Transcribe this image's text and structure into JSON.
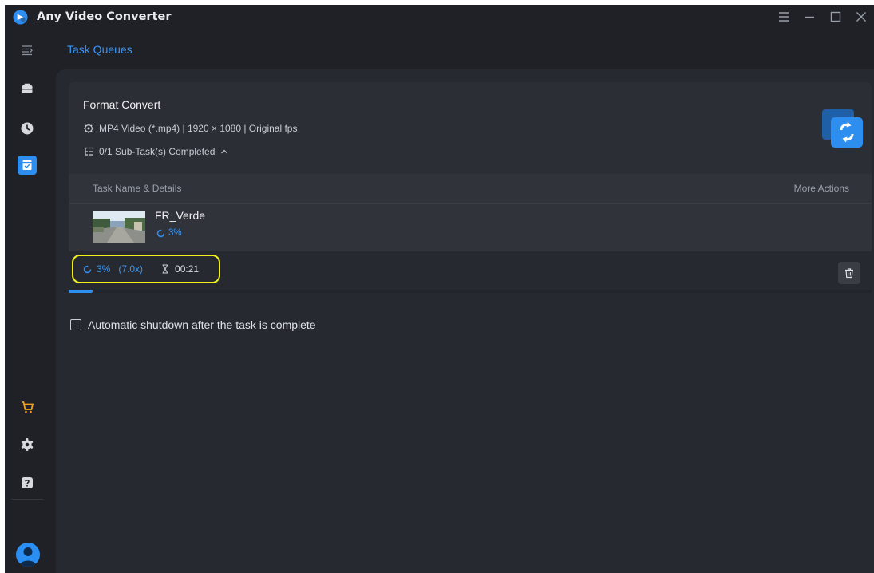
{
  "app": {
    "title": "Any Video Converter"
  },
  "header": {
    "title": "Task Queues"
  },
  "task": {
    "title": "Format Convert",
    "format_line": "MP4 Video (*.mp4) | 1920 × 1080 | Original fps",
    "subtasks_line": "0/1 Sub-Task(s) Completed",
    "table": {
      "col_name": "Task Name & Details",
      "col_actions": "More Actions"
    },
    "file": {
      "name": "FR_Verde",
      "progress_text": "3%"
    },
    "footer": {
      "percent": "3%",
      "speed": "(7.0x)",
      "remaining": "00:21"
    },
    "progress": 0.03
  },
  "shutdown_option": {
    "label": "Automatic shutdown after the task is complete",
    "checked": false
  },
  "colors": {
    "accent": "#2e8ef0",
    "highlight": "#f2f21a",
    "background": "#1f2127"
  },
  "icons": {
    "sidebar": [
      "collapse-menu-icon",
      "toolbox-icon",
      "history-icon",
      "task-queue-icon",
      "cart-icon",
      "gear-icon",
      "help-icon"
    ],
    "window": [
      "menu-icon",
      "minimize-icon",
      "maximize-icon",
      "close-icon"
    ]
  }
}
